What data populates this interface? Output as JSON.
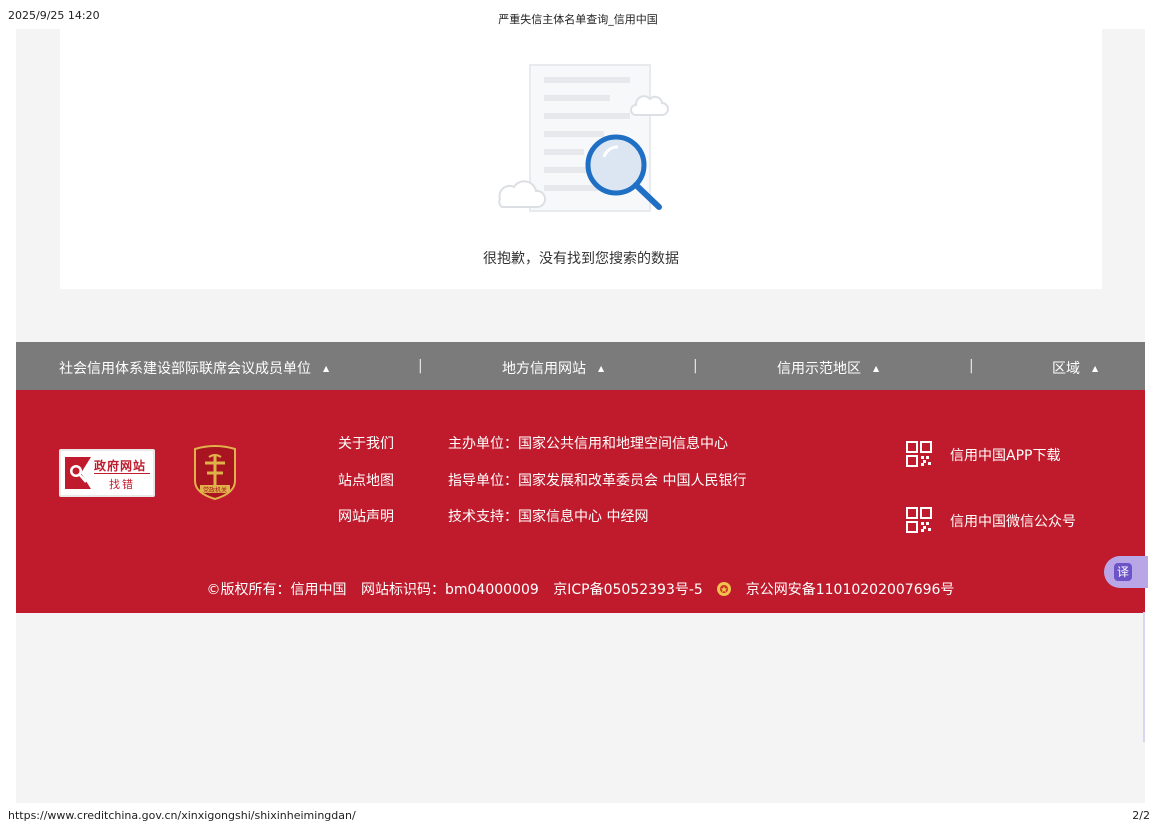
{
  "print_header": {
    "datetime": "2025/9/25 14:20",
    "title": "严重失信主体名单查询_信用中国"
  },
  "print_footer": {
    "url": "https://www.creditchina.gov.cn/xinxigongshi/shixinheimingdan/",
    "page": "2/2"
  },
  "empty_state": {
    "message": "很抱歉，没有找到您搜索的数据"
  },
  "linkbar": {
    "items": [
      {
        "label": "社会信用体系建设部际联席会议成员单位",
        "caret": "▲"
      },
      {
        "label": "地方信用网站",
        "caret": "▲"
      },
      {
        "label": "信用示范地区",
        "caret": "▲"
      },
      {
        "label": "区域",
        "caret": "▲"
      }
    ],
    "separator": "|"
  },
  "footer": {
    "gov_badge": {
      "line1": "政府网站",
      "line2": "找错"
    },
    "party_emblem": {
      "label": "党政机关"
    },
    "links": [
      "关于我们",
      "站点地图",
      "网站声明"
    ],
    "info": [
      "主办单位：国家公共信用和地理空间信息中心",
      "指导单位：国家发展和改革委员会 中国人民银行",
      "技术支持：国家信息中心 中经网"
    ],
    "qr": [
      {
        "label": "信用中国APP下载",
        "icon": "qr-code-icon"
      },
      {
        "label": "信用中国微信公众号",
        "icon": "qr-code-icon"
      }
    ],
    "copyright": {
      "owner": "©版权所有：信用中国",
      "site_id": "网站标识码：bm04000009",
      "icp": "京ICP备05052393号-5",
      "police": "京公网安备11010202007696号"
    }
  },
  "translate_button": {
    "label": "译"
  },
  "colors": {
    "footer_red": "#c01b2d",
    "linkbar_grey": "#7b7b7b",
    "page_bg": "#f4f4f5",
    "accent_blue": "#1f6fc4"
  }
}
